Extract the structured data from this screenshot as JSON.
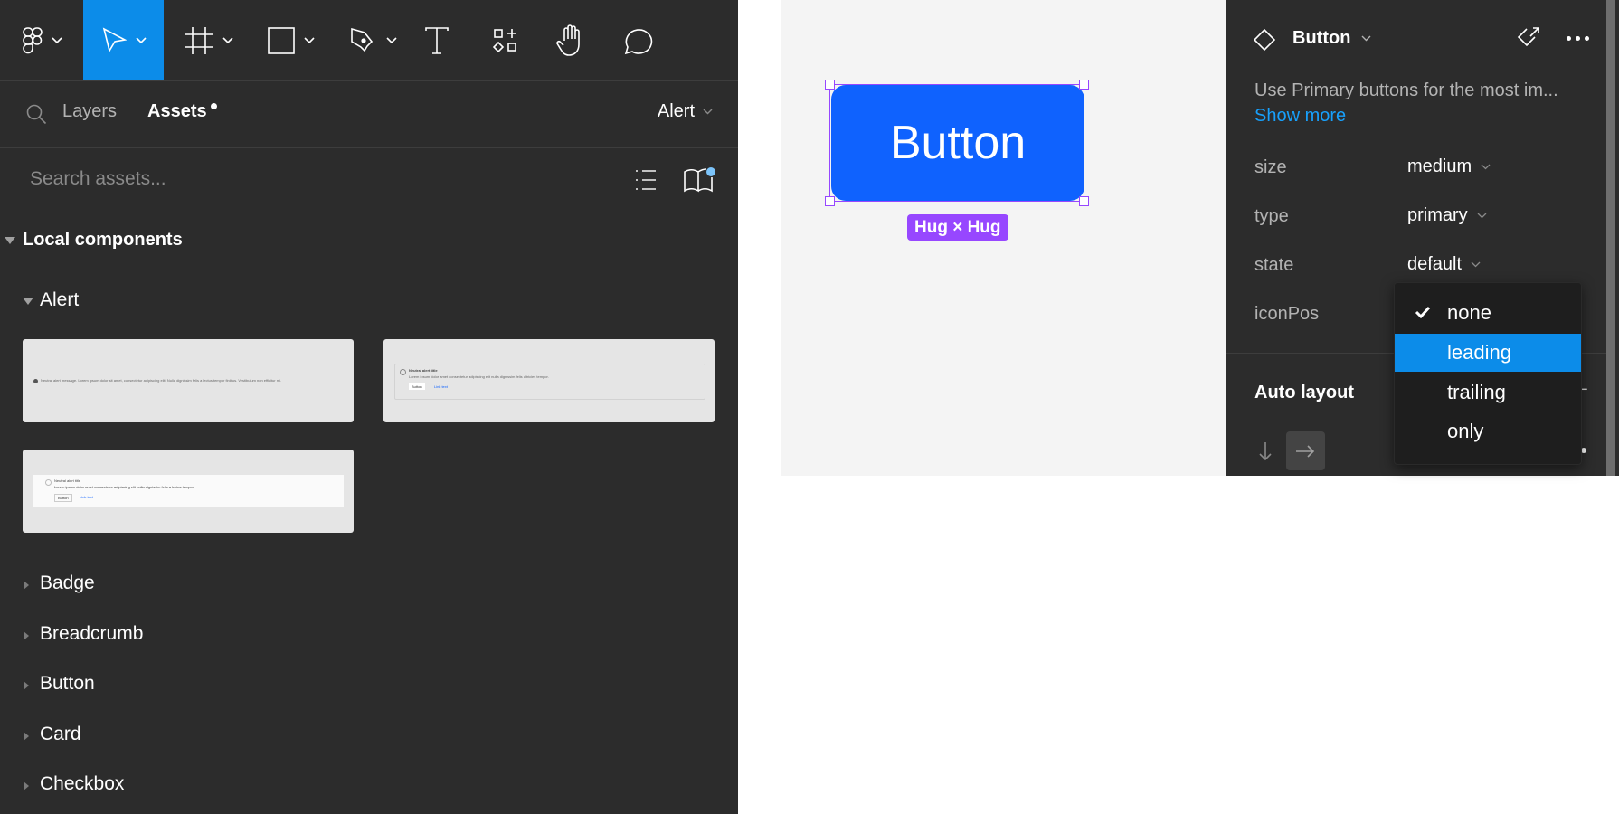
{
  "toolbar": {
    "tools": [
      {
        "name": "main-menu",
        "icon": "figma-logo-icon",
        "has_dropdown": true,
        "active": false
      },
      {
        "name": "move-tool",
        "icon": "cursor-arrow-icon",
        "has_dropdown": true,
        "active": true
      },
      {
        "name": "frame-tool",
        "icon": "frame-hash-icon",
        "has_dropdown": true,
        "active": false
      },
      {
        "name": "shape-tool",
        "icon": "rectangle-icon",
        "has_dropdown": true,
        "active": false
      },
      {
        "name": "pen-tool",
        "icon": "pen-icon",
        "has_dropdown": true,
        "active": false
      },
      {
        "name": "text-tool",
        "icon": "text-t-icon",
        "has_dropdown": false,
        "active": false
      },
      {
        "name": "resources-tool",
        "icon": "components-grid-icon",
        "has_dropdown": false,
        "active": false
      },
      {
        "name": "hand-tool",
        "icon": "hand-icon",
        "has_dropdown": false,
        "active": false
      },
      {
        "name": "comment-tool",
        "icon": "comment-bubble-icon",
        "has_dropdown": false,
        "active": false
      }
    ],
    "active_color": "#0c8ce9"
  },
  "left_panel": {
    "tabs": {
      "layers": "Layers",
      "assets": "Assets"
    },
    "active_tab": "Assets",
    "page_selector": "Alert",
    "search_placeholder": "Search assets...",
    "section_title": "Local components",
    "open_group": "Alert",
    "thumbnails": [
      {
        "variant": "inline",
        "text": "Neutral alert message. Lorem ipsum dolor sit amet, consectetur adipiscing elit. Nulla dignissim felis a lectus tempor finibus. Vestibulum non efficitur mi."
      },
      {
        "variant": "card-bordered",
        "title": "Neutral alert title",
        "text": "Lorem ipsum dolor amet consectetur adipiscing elit nulla dignissim felis ultricies tempor.",
        "button": "Button",
        "link": "Link text"
      },
      {
        "variant": "card-white",
        "title": "Neutral alert title",
        "text": "Lorem ipsum dolor amet consectetur adipiscing elit nulla dignissim felis a lectus tempor.",
        "button": "Button",
        "link": "Link text"
      }
    ],
    "groups": [
      "Badge",
      "Breadcrumb",
      "Button",
      "Card",
      "Checkbox"
    ]
  },
  "canvas": {
    "component_label": "Button",
    "component_color": "#0f62fe",
    "selection_color": "#9747ff",
    "size_badge": "Hug × Hug"
  },
  "right_panel": {
    "component_name": "Button",
    "description": "Use Primary buttons for the most im...",
    "show_more": "Show more",
    "properties": [
      {
        "label": "size",
        "value": "medium"
      },
      {
        "label": "type",
        "value": "primary"
      },
      {
        "label": "state",
        "value": "default"
      },
      {
        "label": "iconPos",
        "value": "none"
      }
    ],
    "auto_layout_title": "Auto layout",
    "auto_layout_remove": "−",
    "dropdown": {
      "options": [
        "none",
        "leading",
        "trailing",
        "only"
      ],
      "checked": "none",
      "highlighted": "leading"
    }
  }
}
